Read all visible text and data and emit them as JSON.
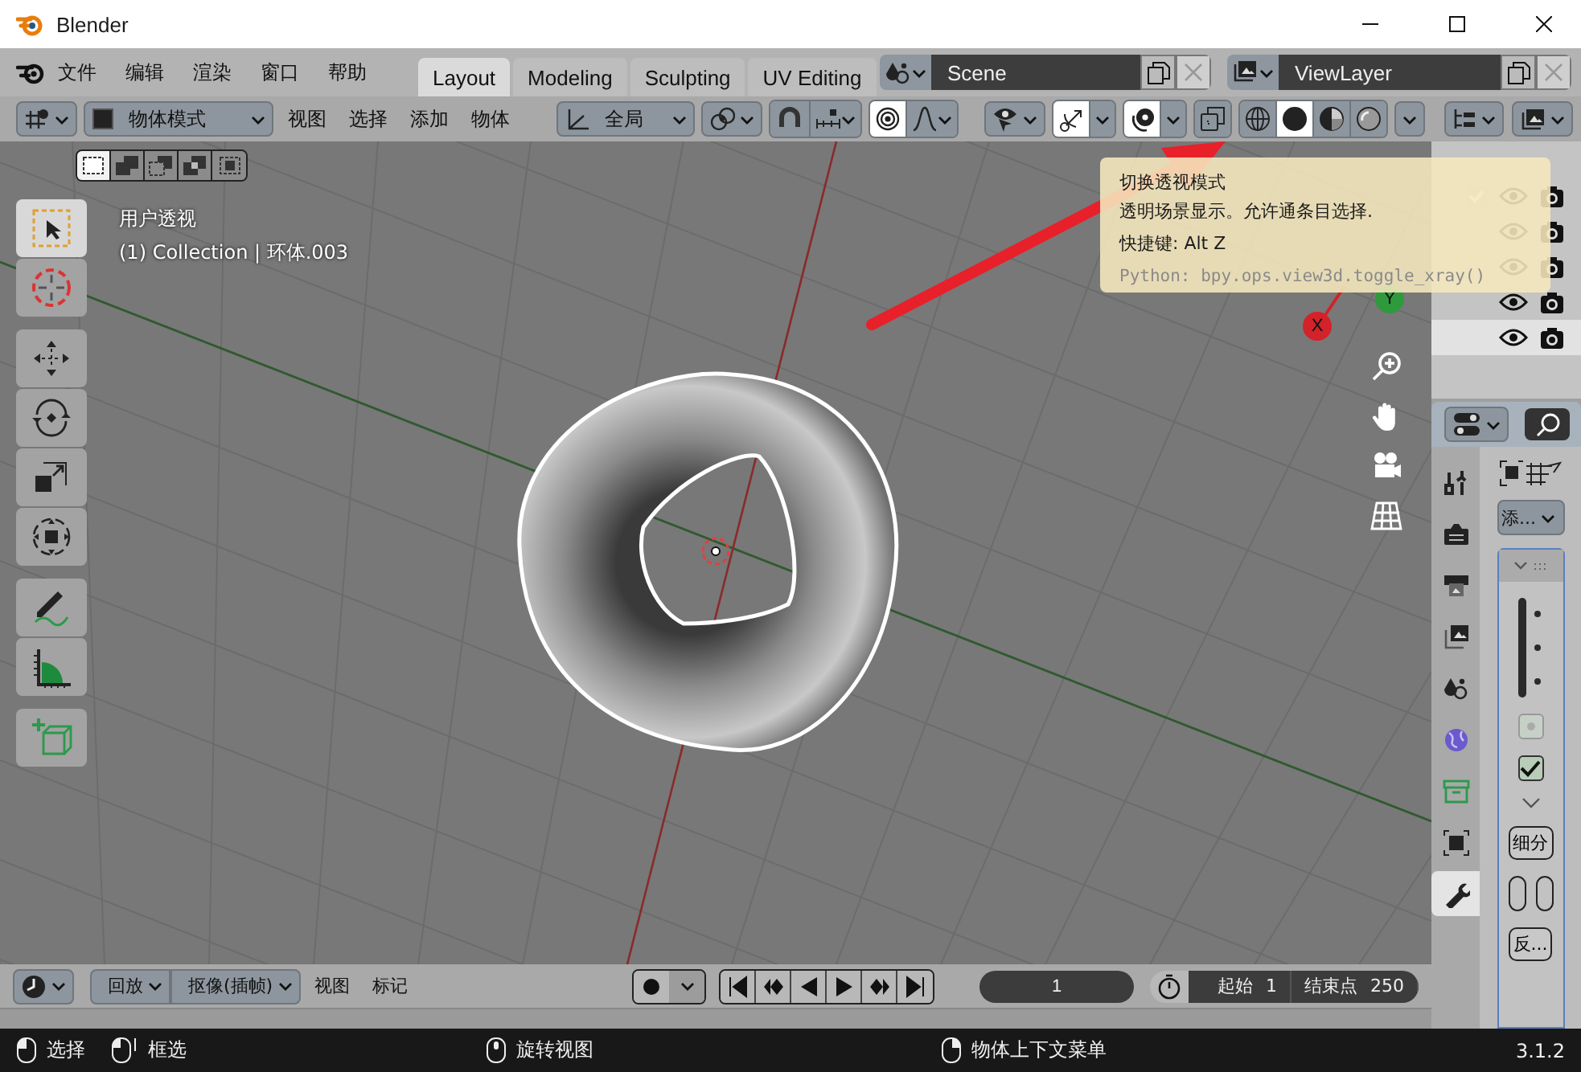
{
  "window": {
    "title": "Blender"
  },
  "menu": [
    "文件",
    "编辑",
    "渲染",
    "窗口",
    "帮助"
  ],
  "workspace_tabs": [
    {
      "label": "Layout",
      "selected": true
    },
    {
      "label": "Modeling",
      "selected": false
    },
    {
      "label": "Sculpting",
      "selected": false
    },
    {
      "label": "UV Editing",
      "selected": false
    }
  ],
  "scene": {
    "name": "Scene"
  },
  "view_layer": {
    "name": "ViewLayer"
  },
  "header": {
    "mode": "物体模式",
    "menus": [
      "视图",
      "选择",
      "添加",
      "物体"
    ],
    "orientation": "全局"
  },
  "shading_modes": [
    {
      "kind": "wireframe",
      "selected": false
    },
    {
      "kind": "solid",
      "selected": true
    },
    {
      "kind": "material",
      "selected": false
    },
    {
      "kind": "rendered",
      "selected": false
    }
  ],
  "select_modes": [
    {
      "kind": "set",
      "selected": true
    },
    {
      "kind": "extend",
      "selected": false
    },
    {
      "kind": "subtract",
      "selected": false
    },
    {
      "kind": "difference",
      "selected": false
    },
    {
      "kind": "intersect",
      "selected": false
    }
  ],
  "tools": [
    {
      "kind": "select",
      "selected": true
    },
    {
      "kind": "cursor",
      "selected": false
    },
    {
      "kind": "move",
      "selected": false
    },
    {
      "kind": "rotate",
      "selected": false
    },
    {
      "kind": "scale",
      "selected": false
    },
    {
      "kind": "transform",
      "selected": false
    },
    {
      "kind": "annotate",
      "selected": false
    },
    {
      "kind": "measure",
      "selected": false
    },
    {
      "kind": "add_cube",
      "selected": false
    }
  ],
  "viewport": {
    "view_name": "用户透视",
    "object_info": "(1) Collection | 环体.003",
    "axes": [
      {
        "label": "Y",
        "color": "#2e9a3c"
      },
      {
        "label": "X",
        "color": "#d3222a"
      }
    ]
  },
  "tooltip": {
    "title": "切换透视模式",
    "description": "透明场景显示。允许通条目选择.",
    "shortcut": "快捷键: Alt Z",
    "python": "Python: bpy.ops.view3d.toggle_xray()"
  },
  "outliner": {
    "rows": [
      {
        "kind": "checkbox",
        "selected": false
      },
      {
        "kind": "plain",
        "selected": false
      },
      {
        "kind": "plain",
        "selected": false
      },
      {
        "kind": "plain",
        "selected": false
      },
      {
        "kind": "plain",
        "selected": true
      }
    ]
  },
  "properties": {
    "tabs": [
      {
        "kind": "tool",
        "selected": false
      },
      {
        "kind": "render",
        "selected": false
      },
      {
        "kind": "output",
        "selected": false
      },
      {
        "kind": "view_layer",
        "selected": false
      },
      {
        "kind": "scene",
        "selected": false
      },
      {
        "kind": "world",
        "selected": false
      },
      {
        "kind": "collection",
        "selected": false
      },
      {
        "kind": "object",
        "selected": false
      },
      {
        "kind": "modifier",
        "selected": true
      }
    ],
    "add_modifier": "添...",
    "checkboxes": [
      {
        "checked": false,
        "disabled": true
      },
      {
        "checked": true,
        "disabled": false
      }
    ],
    "subdivide": "细分",
    "reverse": "反..."
  },
  "timeline": {
    "playback": "回放",
    "keying": "抠像(插帧)",
    "menus": [
      "视图",
      "标记"
    ],
    "current_frame": "1",
    "start_label": "起始",
    "start": "1",
    "end_label": "结束点",
    "end": "250"
  },
  "status_bar": {
    "hints": [
      {
        "kind": "left",
        "label": "选择"
      },
      {
        "kind": "drag",
        "label": "框选"
      },
      {
        "kind": "middle",
        "label": "旋转视图"
      },
      {
        "kind": "right",
        "label": "物体上下文菜单"
      }
    ],
    "version": "3.1.2"
  }
}
